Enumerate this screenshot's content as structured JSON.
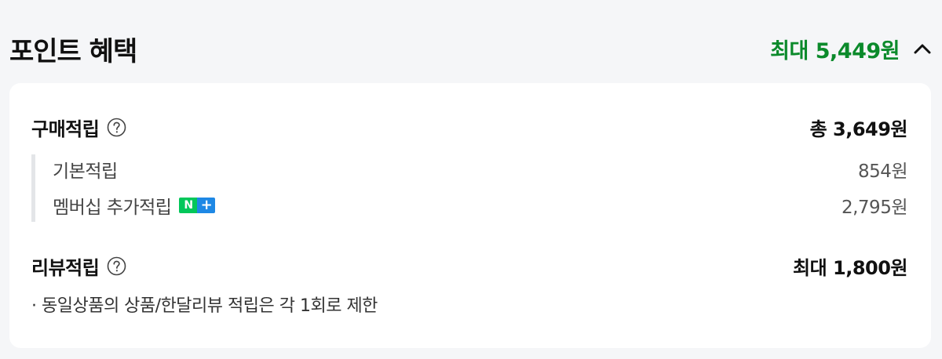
{
  "header": {
    "title": "포인트 혜택",
    "max_total": "최대 5,449원"
  },
  "colors": {
    "accent_green": "#0b8a2b",
    "badge_n": "#03c75a",
    "badge_plus": "#1e88e5"
  },
  "icons": {
    "toggle": "chevron-up-icon",
    "help": "question-circle-icon"
  },
  "purchase": {
    "label": "구매적립",
    "total": "총 3,649원",
    "items": [
      {
        "label": "기본적립",
        "value": "854원"
      },
      {
        "label": "멤버십 추가적립",
        "value": "2,795원",
        "badge_n": "N",
        "badge_plus": "+"
      }
    ]
  },
  "review": {
    "label": "리뷰적립",
    "max": "최대 1,800원",
    "note": "· 동일상품의 상품/한달리뷰 적립은 각 1회로 제한"
  }
}
